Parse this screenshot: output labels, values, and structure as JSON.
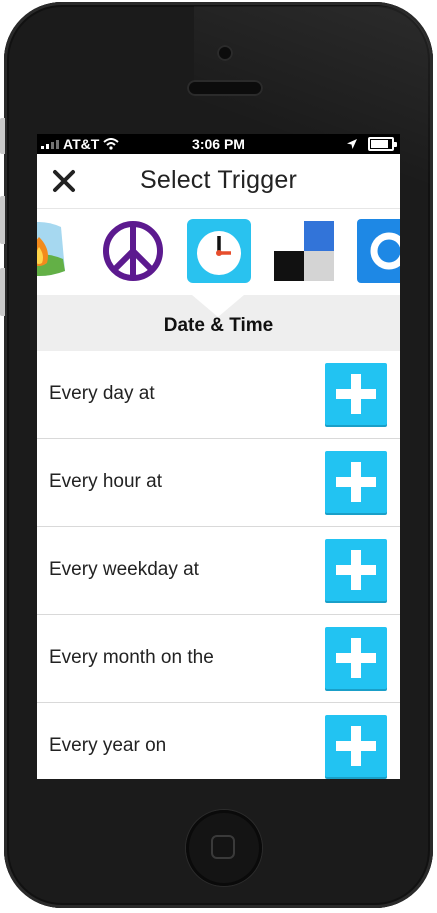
{
  "status_bar": {
    "carrier": "AT&T",
    "time": "3:06 PM",
    "battery_level": 0.85
  },
  "nav": {
    "title": "Select Trigger",
    "close_icon": "close-icon"
  },
  "channels": [
    {
      "name": "campfire-icon",
      "selected": false
    },
    {
      "name": "peace-icon",
      "selected": false
    },
    {
      "name": "clock-icon",
      "selected": true
    },
    {
      "name": "delicious-icon",
      "selected": false
    },
    {
      "name": "blue-ring-icon",
      "selected": false
    }
  ],
  "section": {
    "title": "Date & Time"
  },
  "triggers": [
    {
      "label": "Every day at"
    },
    {
      "label": "Every hour at"
    },
    {
      "label": "Every weekday at"
    },
    {
      "label": "Every month on the"
    },
    {
      "label": "Every year on"
    }
  ],
  "colors": {
    "accent": "#22c3f2",
    "peace": "#5c1a8f"
  }
}
